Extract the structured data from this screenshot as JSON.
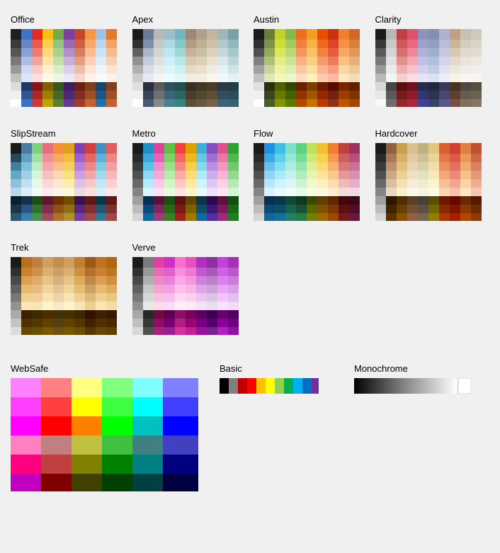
{
  "palettes": [
    {
      "name": "Office",
      "id": "office"
    },
    {
      "name": "Apex",
      "id": "apex"
    },
    {
      "name": "Austin",
      "id": "austin"
    },
    {
      "name": "Clarity",
      "id": "clarity"
    },
    {
      "name": "SlipStream",
      "id": "slipstream"
    },
    {
      "name": "Metro",
      "id": "metro"
    },
    {
      "name": "Flow",
      "id": "flow"
    },
    {
      "name": "Hardcover",
      "id": "hardcover"
    },
    {
      "name": "Trek",
      "id": "trek"
    },
    {
      "name": "Verve",
      "id": "verve"
    }
  ],
  "bottom": {
    "websafe": "WebSafe",
    "basic": "Basic",
    "monochrome": "Monochrome"
  }
}
